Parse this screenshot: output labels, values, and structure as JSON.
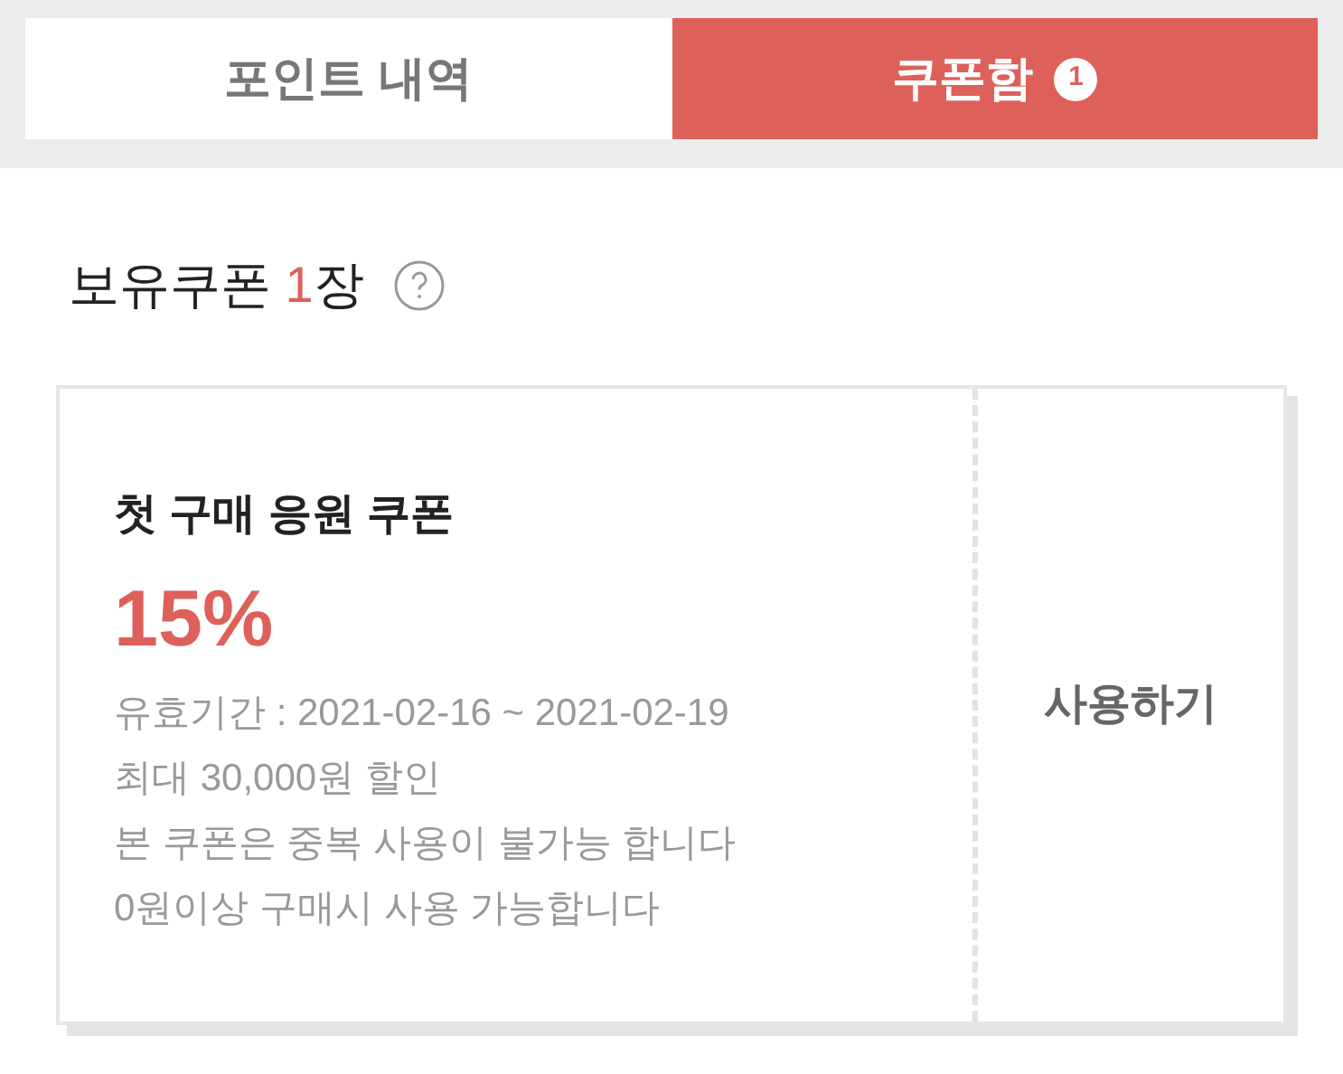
{
  "tabs": [
    {
      "label": "포인트 내역",
      "selected": false
    },
    {
      "label": "쿠폰함",
      "badge": "1",
      "selected": true
    }
  ],
  "summary": {
    "label": "보유쿠폰",
    "count": "1",
    "unit": "장"
  },
  "coupons": [
    {
      "title": "첫 구매 응원 쿠폰",
      "discount": "15%",
      "details": [
        "유효기간 : 2021-02-16 ~ 2021-02-19",
        "최대 30,000원 할인",
        "본 쿠폰은 중복 사용이 불가능 합니다",
        "0원이상 구매시 사용 가능합니다"
      ],
      "action": "사용하기"
    }
  ]
}
